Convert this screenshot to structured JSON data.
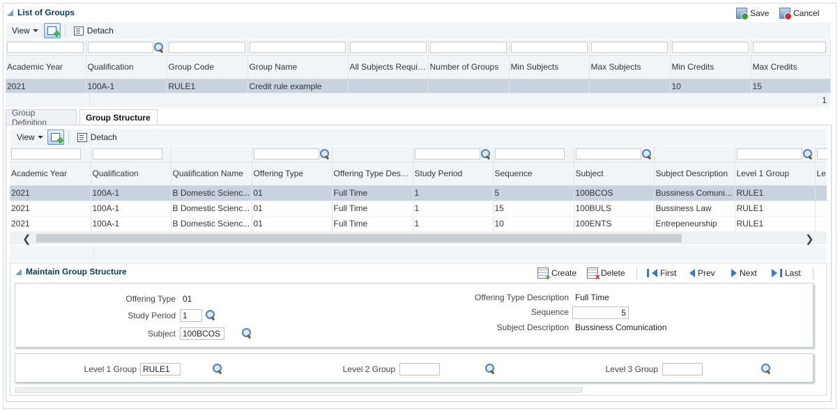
{
  "top": {
    "title": "List of Groups",
    "save_label": "Save",
    "cancel_label": "Cancel",
    "view_label": "View",
    "detach_label": "Detach",
    "columns": [
      "Academic Year",
      "Qualification",
      "Group Code",
      "Group Name",
      "All Subjects Required",
      "Number of Groups",
      "Min Subjects",
      "Max Subjects",
      "Min Credits",
      "Max Credits"
    ],
    "rows": [
      [
        "2021",
        "100A-1",
        "RULE1",
        "Credit rule example",
        "",
        "",
        "",
        "",
        "10",
        "15"
      ]
    ],
    "page_number": "1"
  },
  "tabs": [
    {
      "label": "Group Definition"
    },
    {
      "label": "Group Structure"
    }
  ],
  "structure": {
    "view_label": "View",
    "detach_label": "Detach",
    "columns": [
      "Academic Year",
      "Qualification",
      "Qualification Name",
      "Offering Type",
      "Offering Type Description",
      "Study Period",
      "Sequence",
      "Subject",
      "Subject Description",
      "Level 1 Group",
      "Le"
    ],
    "rows": [
      [
        "2021",
        "100A-1",
        "B Domestic Scienc...",
        "01",
        "Full Time",
        "1",
        "5",
        "100BCOS",
        "Bussiness Comuni...",
        "RULE1",
        ""
      ],
      [
        "2021",
        "100A-1",
        "B Domestic Scienc...",
        "01",
        "Full Time",
        "1",
        "15",
        "100BULS",
        "Bussiness Law",
        "RULE1",
        ""
      ],
      [
        "2021",
        "100A-1",
        "B Domestic Scienc...",
        "01",
        "Full Time",
        "1",
        "10",
        "100ENTS",
        "Entrepeneurship",
        "RULE1",
        ""
      ]
    ]
  },
  "maintain": {
    "title": "Maintain Group Structure",
    "create_label": "Create",
    "delete_label": "Delete",
    "first_label": "First",
    "prev_label": "Prev",
    "next_label": "Next",
    "last_label": "Last",
    "offering_type_label": "Offering Type",
    "offering_type_value": "01",
    "study_period_label": "Study Period",
    "study_period_value": "1",
    "subject_label": "Subject",
    "subject_value": "100BCOS",
    "offering_type_desc_label": "Offering Type Description",
    "offering_type_desc_value": "Full Time",
    "sequence_label": "Sequence",
    "sequence_value": "5",
    "subject_desc_label": "Subject Description",
    "subject_desc_value": "Bussiness Comunication",
    "level1_label": "Level 1 Group",
    "level1_value": "RULE1",
    "level2_label": "Level 2 Group",
    "level2_value": "",
    "level3_label": "Level 3 Group",
    "level3_value": ""
  }
}
